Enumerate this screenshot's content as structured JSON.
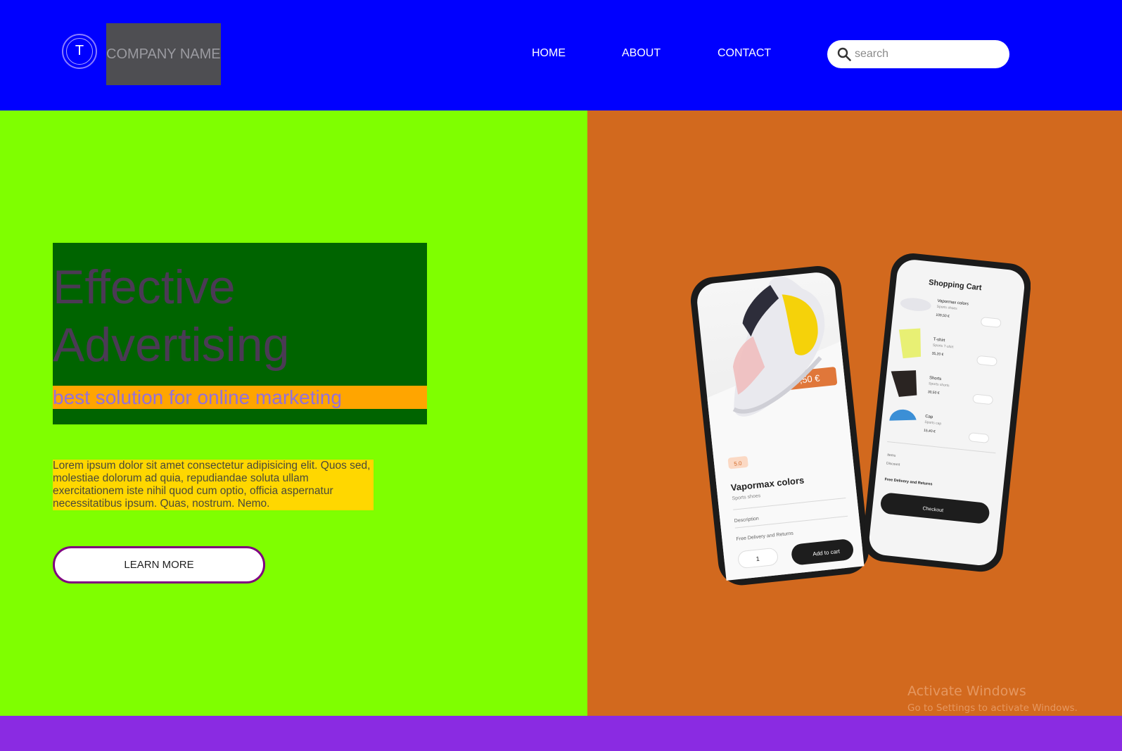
{
  "header": {
    "logo_letter": "T",
    "company_name": "COMPANY NAME",
    "nav": [
      "HOME",
      "ABOUT",
      "CONTACT"
    ],
    "search_placeholder": "search"
  },
  "hero": {
    "title": "Effective Advertising",
    "subtitle": "best solution for online marketing",
    "paragraph": "Lorem ipsum dolor sit amet consectetur adipisicing elit. Quos sed, molestiae dolorum ad quia, repudiandae soluta ullam exercitationem iste nihil quod cum optio, officia aspernatur necessitatibus ipsum. Quas, nostrum. Nemo.",
    "button_label": "LEARN MORE"
  },
  "phone_mockup": {
    "left_screen": {
      "price": "0,50 €",
      "rating": "5.0",
      "product": "Vapormax colors",
      "category": "Sports shoes",
      "rows": [
        "Description",
        "Free Delivery and Returns"
      ],
      "qty": "1",
      "add_to_cart": "Add to cart"
    },
    "right_screen": {
      "title": "Shopping Cart",
      "items": [
        {
          "name": "Vapormax colors",
          "sub": "Sports shoes",
          "price": "109,50 €"
        },
        {
          "name": "T-shirt",
          "sub": "Sports T-shirt",
          "price": "35,20 €"
        },
        {
          "name": "Shorts",
          "sub": "Sports shorts",
          "price": "30,50 €"
        },
        {
          "name": "Cap",
          "sub": "Sports cap",
          "price": "15,40 €"
        }
      ],
      "totals": [
        "Items",
        "Discount",
        "Free Delivery and Returns"
      ],
      "checkout": "Checkout"
    }
  },
  "watermark": {
    "title": "Activate Windows",
    "subtitle": "Go to Settings to activate Windows."
  },
  "colors": {
    "header_bg": "#0000ff",
    "hero_left_bg": "#7fff00",
    "hero_right_bg": "#d2691e",
    "title_box_bg": "#006400",
    "subtitle_bg": "#ffa500",
    "paragraph_bg": "#ffd700",
    "footer_bg": "#8a2be2",
    "button_border": "#800080"
  }
}
